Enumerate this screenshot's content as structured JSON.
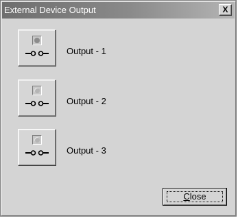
{
  "window": {
    "title": "External Device Output",
    "close_glyph": "X"
  },
  "outputs": [
    {
      "label": "Output - 1",
      "state": "on",
      "icon": "switch-icon"
    },
    {
      "label": "Output - 2",
      "state": "off",
      "icon": "switch-icon"
    },
    {
      "label": "Output - 3",
      "state": "off",
      "icon": "switch-icon"
    }
  ],
  "footer": {
    "close_mnemonic": "C",
    "close_rest": "lose"
  },
  "colors": {
    "face": "#d4d4d4",
    "title_gradient_start": "#6e6e6e",
    "title_gradient_end": "#b4b4b4",
    "lamp_on": "#8c8c8c",
    "lamp_off": "#b5b5b5"
  }
}
